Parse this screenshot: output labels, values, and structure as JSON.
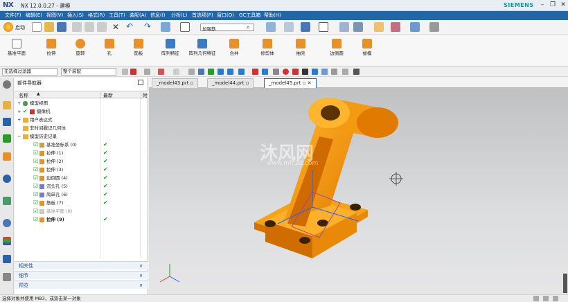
{
  "app": {
    "logo": "NX",
    "title": "NX 12.0.0.27 - 建模",
    "brand": "SIEMENS"
  },
  "menu": [
    "文件(F)",
    "编辑(E)",
    "视图(V)",
    "插入(S)",
    "格式(R)",
    "工具(T)",
    "装配(A)",
    "信息(I)",
    "分析(L)",
    "首选项(P)",
    "窗口(O)",
    "GC工具箱",
    "帮助(H)"
  ],
  "toolbar": {
    "start_label": "启动",
    "search_value": "加强筋"
  },
  "ribbon": [
    "基准平面",
    "拉伸",
    "旋转",
    "孔",
    "筋板",
    "阵列特征",
    "阵列几何特征",
    "合并",
    "修剪体",
    "抽壳",
    "边倒圆",
    "拔模"
  ],
  "selection": {
    "filter": "无选择过滤器",
    "scope": "整个装配"
  },
  "navigator": {
    "title": "部件导航器",
    "columns": {
      "name": "名称",
      "latest": "最新",
      "extra": "附"
    },
    "items": [
      {
        "label": "模型视图",
        "indent": 1,
        "check": ""
      },
      {
        "label": "摄像机",
        "indent": 1,
        "check": ""
      },
      {
        "label": "用户表达式",
        "indent": 1,
        "check": ""
      },
      {
        "label": "非时间戳记几何体",
        "indent": 1,
        "check": ""
      },
      {
        "label": "模型历史记录",
        "indent": 1,
        "check": ""
      },
      {
        "label": "基准坐标系 (0)",
        "indent": 2,
        "check": "✔"
      },
      {
        "label": "拉伸 (1)",
        "indent": 2,
        "check": "✔"
      },
      {
        "label": "拉伸 (2)",
        "indent": 2,
        "check": "✔"
      },
      {
        "label": "拉伸 (3)",
        "indent": 2,
        "check": "✔"
      },
      {
        "label": "边倒圆 (4)",
        "indent": 2,
        "check": "✔"
      },
      {
        "label": "沉头孔 (5)",
        "indent": 2,
        "check": "✔"
      },
      {
        "label": "简单孔 (6)",
        "indent": 2,
        "check": "✔"
      },
      {
        "label": "筋板 (7)",
        "indent": 2,
        "check": "✔"
      },
      {
        "label": "基准平面 (8)",
        "indent": 2,
        "check": ""
      },
      {
        "label": "拉伸 (9)",
        "indent": 2,
        "check": "✔"
      }
    ],
    "groups": [
      "相关性",
      "细节",
      "预览"
    ]
  },
  "tabs": [
    "_model43.prt",
    "_model44.prt",
    "_model45.prt"
  ],
  "viewport": {
    "watermark_name": "沐风网",
    "watermark_url": "www.mfcad.com"
  },
  "status": "选择对象并使用 MB3，或双击某一对象",
  "colors": {
    "menubar": "#2266a8",
    "part": "#f39a0c",
    "checkmark": "#1ea51e"
  }
}
